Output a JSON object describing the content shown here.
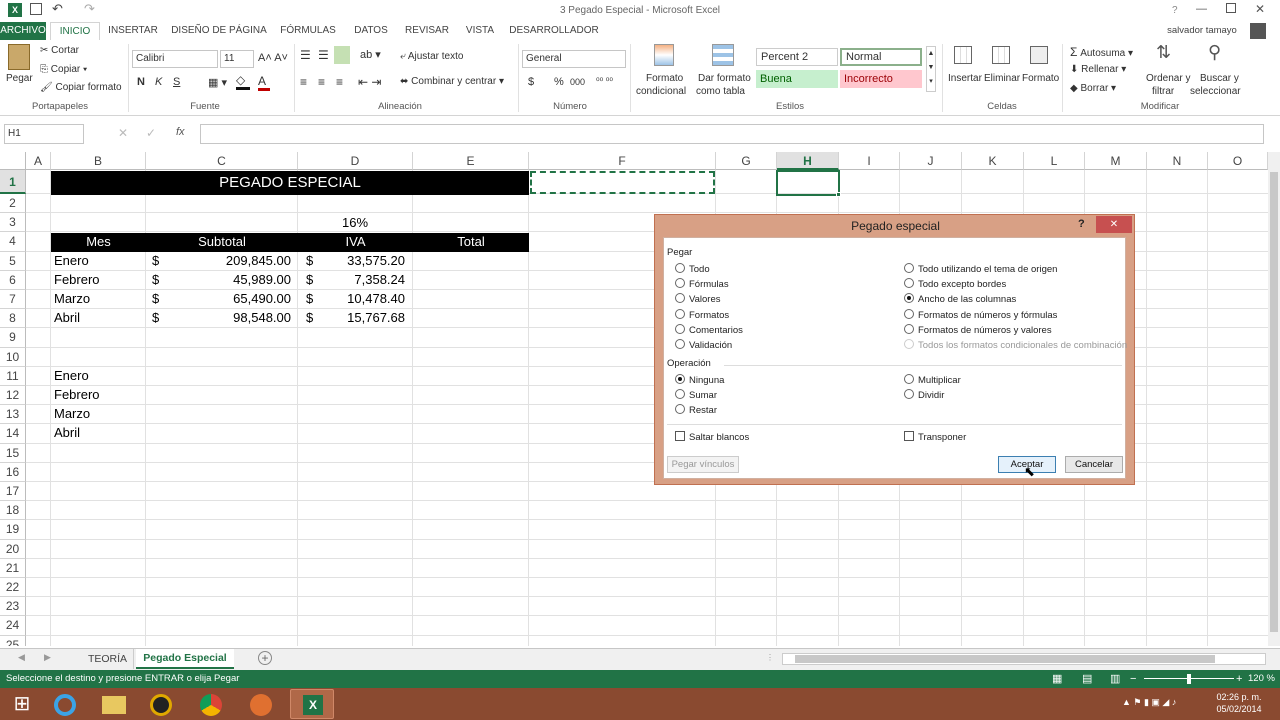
{
  "window": {
    "title": "3 Pegado Especial - Microsoft Excel",
    "user": "salvador tamayo"
  },
  "tabs": [
    "ARCHIVO",
    "INICIO",
    "INSERTAR",
    "DISEÑO DE PÁGINA",
    "FÓRMULAS",
    "DATOS",
    "REVISAR",
    "VISTA",
    "DESARROLLADOR"
  ],
  "ribbon": {
    "paste": "Pegar",
    "cut": "Cortar",
    "copy": "Copiar",
    "format_painter": "Copiar formato",
    "clipboard_label": "Portapapeles",
    "font_name": "Calibri",
    "font_size": "11",
    "font_label": "Fuente",
    "bold": "N",
    "italic": "K",
    "underline": "S",
    "wrap": "Ajustar texto",
    "merge": "Combinar y centrar",
    "align_label": "Alineación",
    "number_format": "General",
    "number_label": "Número",
    "currency": "$",
    "percent": "%",
    "thousands": "000",
    "cond_format_1": "Formato",
    "cond_format_2": "condicional",
    "as_table_1": "Dar formato",
    "as_table_2": "como tabla",
    "styles": {
      "percent2": "Percent 2",
      "normal": "Normal",
      "buena": "Buena",
      "incorrecto": "Incorrecto"
    },
    "styles_label": "Estilos",
    "insert": "Insertar",
    "delete": "Eliminar",
    "format": "Formato",
    "cells_label": "Celdas",
    "autosum": "Autosuma",
    "fill": "Rellenar",
    "clear": "Borrar",
    "sort_1": "Ordenar y",
    "sort_2": "filtrar",
    "find_1": "Buscar y",
    "find_2": "seleccionar",
    "edit_label": "Modificar"
  },
  "formula_bar": {
    "name_box": "H1",
    "fx": "fx",
    "value": ""
  },
  "columns": [
    "A",
    "B",
    "C",
    "D",
    "E",
    "F",
    "G",
    "H",
    "I",
    "J",
    "K",
    "L",
    "M",
    "N",
    "O"
  ],
  "rows": [
    "1",
    "2",
    "3",
    "4",
    "5",
    "6",
    "7",
    "8",
    "9",
    "10",
    "11",
    "12",
    "13",
    "14",
    "15",
    "16",
    "17",
    "18",
    "19",
    "20",
    "21",
    "22",
    "23",
    "24",
    "25"
  ],
  "sheet": {
    "title": "PEGADO ESPECIAL",
    "rate": "16%",
    "headers": [
      "Mes",
      "Subtotal",
      "IVA",
      "Total"
    ],
    "data": [
      {
        "mes": "Enero",
        "s1": "$",
        "subtotal": "209,845.00",
        "s2": "$",
        "iva": "33,575.20"
      },
      {
        "mes": "Febrero",
        "s1": "$",
        "subtotal": "45,989.00",
        "s2": "$",
        "iva": "7,358.24"
      },
      {
        "mes": "Marzo",
        "s1": "$",
        "subtotal": "65,490.00",
        "s2": "$",
        "iva": "10,478.40"
      },
      {
        "mes": "Abril",
        "s1": "$",
        "subtotal": "98,548.00",
        "s2": "$",
        "iva": "15,767.68"
      }
    ],
    "months2": [
      "Enero",
      "Febrero",
      "Marzo",
      "Abril"
    ]
  },
  "dialog": {
    "title": "Pegado especial",
    "help": "?",
    "close": "✕",
    "paste_label": "Pegar",
    "paste_left": [
      "Todo",
      "Fórmulas",
      "Valores",
      "Formatos",
      "Comentarios",
      "Validación"
    ],
    "paste_right": [
      "Todo utilizando el tema de origen",
      "Todo excepto bordes",
      "Ancho de las columnas",
      "Formatos de números y fórmulas",
      "Formatos de números y valores",
      "Todos los formatos condicionales de combinación"
    ],
    "op_label": "Operación",
    "op_left": [
      "Ninguna",
      "Sumar",
      "Restar"
    ],
    "op_right": [
      "Multiplicar",
      "Dividir"
    ],
    "skip_blanks": "Saltar blancos",
    "transpose": "Transponer",
    "paste_link": "Pegar vínculos",
    "ok": "Aceptar",
    "cancel": "Cancelar"
  },
  "sheet_tabs": [
    "TEORÍA",
    "Pegado Especial"
  ],
  "status": {
    "message": "Seleccione el destino y presione ENTRAR o elija Pegar",
    "zoom": "120 %"
  },
  "taskbar": {
    "time": "02:26 p. m.",
    "date": "05/02/2014"
  }
}
